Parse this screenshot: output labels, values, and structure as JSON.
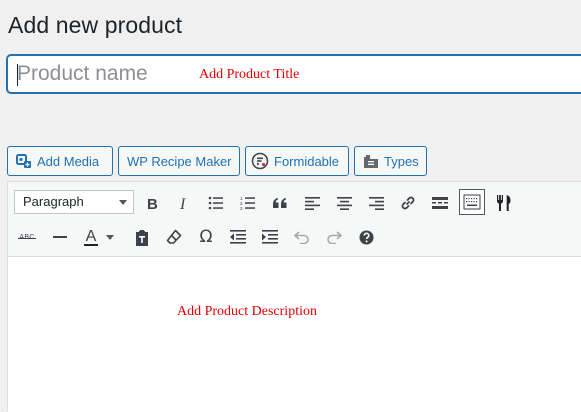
{
  "page": {
    "title": "Add new product"
  },
  "title_field": {
    "placeholder": "Product name",
    "value": ""
  },
  "annotations": {
    "title": "Add Product Title",
    "description": "Add Product Description"
  },
  "media_buttons": [
    {
      "label": "Add Media",
      "icon": "add-media-icon"
    },
    {
      "label": "WP Recipe Maker",
      "icon": ""
    },
    {
      "label": "Formidable",
      "icon": "formidable-icon"
    },
    {
      "label": "Types",
      "icon": "types-icon"
    }
  ],
  "toolbar": {
    "format_select": "Paragraph",
    "row1_icons": [
      "bold-icon",
      "italic-icon",
      "bulleted-list-icon",
      "numbered-list-icon",
      "blockquote-icon",
      "align-left-icon",
      "align-center-icon",
      "align-right-icon",
      "insert-link-icon",
      "read-more-icon",
      "toolbar-toggle-icon",
      "recipe-icon"
    ],
    "row2_icons": [
      "strikethrough-icon",
      "horizontal-line-icon",
      "text-color-icon",
      "paste-as-text-icon",
      "clear-formatting-icon",
      "special-character-icon",
      "outdent-icon",
      "indent-icon",
      "undo-icon",
      "redo-icon",
      "help-icon"
    ],
    "strikethrough_label": "ABC",
    "text_color_label": "A",
    "special_char_label": "Ω"
  },
  "colors": {
    "accent": "#2271b1",
    "annotation": "#e00000",
    "toolbar_icon": "#50575e"
  }
}
